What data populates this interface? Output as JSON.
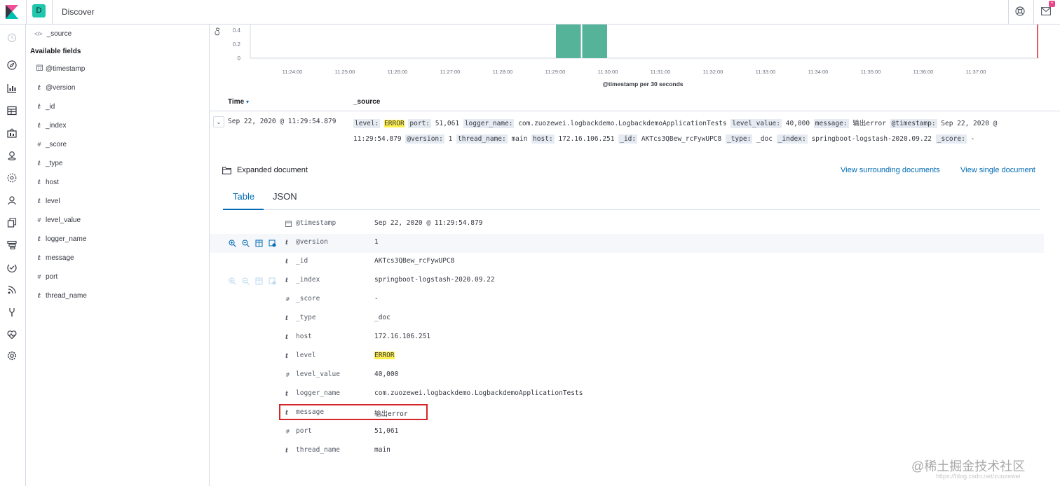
{
  "topbar": {
    "space_letter": "D",
    "app_title": "Discover",
    "notification_count": "•"
  },
  "sidebar": {
    "source_label": "_source",
    "heading": "Available fields",
    "fields": [
      {
        "type": "date",
        "name": "@timestamp"
      },
      {
        "type": "t",
        "name": "@version"
      },
      {
        "type": "t",
        "name": "_id"
      },
      {
        "type": "t",
        "name": "_index"
      },
      {
        "type": "#",
        "name": "_score"
      },
      {
        "type": "t",
        "name": "_type"
      },
      {
        "type": "t",
        "name": "host"
      },
      {
        "type": "t",
        "name": "level"
      },
      {
        "type": "#",
        "name": "level_value"
      },
      {
        "type": "t",
        "name": "logger_name"
      },
      {
        "type": "t",
        "name": "message"
      },
      {
        "type": "#",
        "name": "port"
      },
      {
        "type": "t",
        "name": "thread_name"
      }
    ]
  },
  "chart_data": {
    "type": "bar",
    "xlabel": "@timestamp per 30 seconds",
    "ylabel": "Co",
    "yticks": [
      "0.4",
      "0.2",
      "0"
    ],
    "ylim": [
      0,
      0.6
    ],
    "categories": [
      "11:24:00",
      "11:25:00",
      "11:26:00",
      "11:27:00",
      "11:28:00",
      "11:29:00",
      "11:30:00",
      "11:31:00",
      "11:32:00",
      "11:33:00",
      "11:34:00",
      "11:35:00",
      "11:36:00",
      "11:37:00"
    ],
    "bars": [
      {
        "x": "11:29:00",
        "value": 1
      },
      {
        "x": "11:29:30",
        "value": 1
      }
    ],
    "bar_color": "#54b399",
    "now_marker_color": "#d6262a"
  },
  "table": {
    "col_time": "Time",
    "col_source": "_source",
    "row_time": "Sep 22, 2020 @ 11:29:54.879",
    "source_pairs": [
      {
        "k": "level:",
        "v": "ERROR",
        "hl": true
      },
      {
        "k": "port:",
        "v": "51,061"
      },
      {
        "k": "logger_name:",
        "v": "com.zuozewei.logbackdemo.LogbackdemoApplicationTests"
      },
      {
        "k": "level_value:",
        "v": "40,000"
      },
      {
        "k": "message:",
        "v": "输出error"
      },
      {
        "k": "@timestamp:",
        "v": "Sep 22, 2020 @ 11:29:54.879"
      },
      {
        "k": "@version:",
        "v": "1"
      },
      {
        "k": "thread_name:",
        "v": "main"
      },
      {
        "k": "host:",
        "v": "172.16.106.251"
      },
      {
        "k": "_id:",
        "v": "AKTcs3QBew_rcFywUPC8"
      },
      {
        "k": "_type:",
        "v": "_doc"
      },
      {
        "k": "_index:",
        "v": "springboot-logstash-2020.09.22"
      },
      {
        "k": "_score:",
        "v": " -"
      }
    ]
  },
  "expanded": {
    "title": "Expanded document",
    "link_surrounding": "View surrounding documents",
    "link_single": "View single document",
    "tab_table": "Table",
    "tab_json": "JSON",
    "rows": [
      {
        "type": "date",
        "key": "@timestamp",
        "value": "Sep 22, 2020 @ 11:29:54.879"
      },
      {
        "type": "t",
        "key": "@version",
        "value": "1"
      },
      {
        "type": "t",
        "key": "_id",
        "value": "AKTcs3QBew_rcFywUPC8"
      },
      {
        "type": "t",
        "key": "_index",
        "value": "springboot-logstash-2020.09.22"
      },
      {
        "type": "#",
        "key": "_score",
        "value": " -"
      },
      {
        "type": "t",
        "key": "_type",
        "value": "_doc"
      },
      {
        "type": "t",
        "key": "host",
        "value": "172.16.106.251"
      },
      {
        "type": "t",
        "key": "level",
        "value": "ERROR",
        "hl": true
      },
      {
        "type": "#",
        "key": "level_value",
        "value": "40,000"
      },
      {
        "type": "t",
        "key": "logger_name",
        "value": "com.zuozewei.logbackdemo.LogbackdemoApplicationTests"
      },
      {
        "type": "t",
        "key": "message",
        "value": "输出error"
      },
      {
        "type": "#",
        "key": "port",
        "value": "51,061"
      },
      {
        "type": "t",
        "key": "thread_name",
        "value": "main"
      }
    ]
  },
  "watermark": {
    "main": "@稀土掘金技术社区",
    "sub": "https://blog.csdn.net/zuozewei"
  },
  "colors": {
    "accent": "#006bb4",
    "highlight": "#fff04f",
    "annotation": "#d6262a"
  }
}
